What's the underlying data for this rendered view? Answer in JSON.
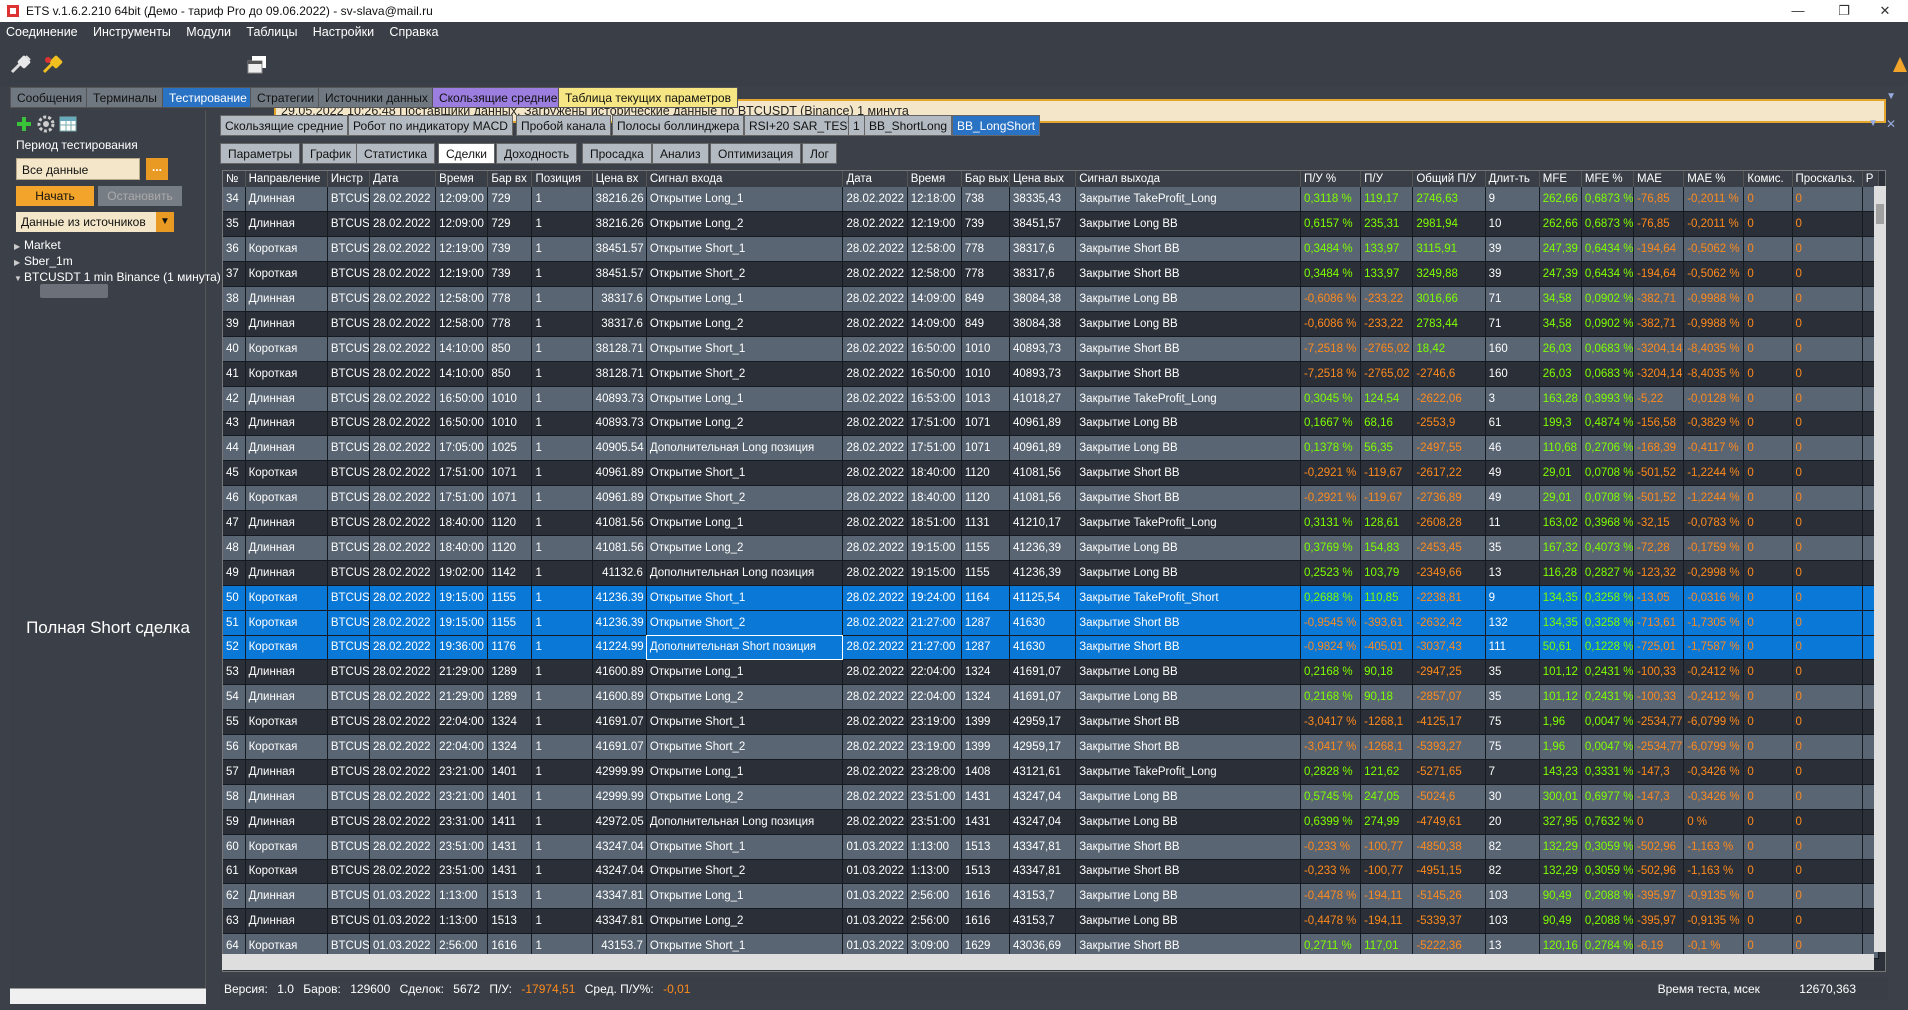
{
  "window": {
    "title": "ETS v.1.6.2.210 64bit  (Демо - тариф Pro до 09.06.2022) - sv-slava@mail.ru",
    "minimize": "—",
    "restore": "❐",
    "close": "✕"
  },
  "menu": [
    "Соединение",
    "Инструменты",
    "Модули",
    "Таблицы",
    "Настройки",
    "Справка"
  ],
  "status_message": "29.05.2022 10:26:48 Поставщики данных. Загружены исторические данные по BTCUSDT (Binance) 1 минута",
  "main_tabs": [
    {
      "label": "Сообщения",
      "state": "normal"
    },
    {
      "label": "Терминалы",
      "state": "normal"
    },
    {
      "label": "Тестирование",
      "state": "active"
    },
    {
      "label": "Стратегии",
      "state": "normal"
    },
    {
      "label": "Источники данных",
      "state": "normal"
    },
    {
      "label": "Скользящие средние",
      "state": "purple"
    },
    {
      "label": "Таблица текущих параметров",
      "state": "yellow"
    }
  ],
  "sidebar": {
    "period_label": "Период тестирования",
    "period_value": "Все данные",
    "browse": "...",
    "start_button": "Начать",
    "stop_button": "Остановить",
    "source_select": "Данные из источников",
    "tree": [
      "Market",
      "Sber_1m",
      "BTCUSDT 1 min Binance (1 минута)"
    ],
    "annotation": "Полная Short сделка"
  },
  "strategy_tabs": [
    "Скользящие средние",
    "Робот по индикатору MACD",
    "Пробой канала",
    "Полосы боллинджера",
    "RSI+20 SAR_TEST",
    "1",
    "BB_ShortLong",
    "BB_LongShort"
  ],
  "strategy_active": 7,
  "sub_tabs": [
    "Параметры",
    "График",
    "Статистика",
    "Сделки",
    "Доходность",
    "Просадка",
    "Анализ",
    "Оптимизация",
    "Лог"
  ],
  "sub_active": 3,
  "table": {
    "columns": [
      "№",
      "Направление",
      "Инстр",
      "Дата",
      "Время",
      "Бар вх",
      "Позиция",
      "Цена вх",
      "Сигнал входа",
      "Дата",
      "Время",
      "Бар вых",
      "Цена вых",
      "Сигнал выхода",
      "П/У %",
      "П/У",
      "Общий П/У",
      "Длит-ть",
      "MFE",
      "MFE %",
      "MAE",
      "MAE %",
      "Комис.",
      "Проскальз.",
      "Р"
    ],
    "rows": [
      [
        "34",
        "Длинная",
        "BTCUSD",
        "28.02.2022",
        "12:09:00",
        "729",
        "1",
        "38216.26",
        "Открытие Long_1",
        "28.02.2022",
        "12:18:00",
        "738",
        "38335,43",
        "Закрытие TakeProfit_Long",
        "0,3118 %",
        "119,17",
        "2746,63",
        "9",
        "262,66",
        "0,6873 %",
        "-76,85",
        "-0,2011 %",
        "0",
        "0"
      ],
      [
        "35",
        "Длинная",
        "BTCUSD",
        "28.02.2022",
        "12:09:00",
        "729",
        "1",
        "38216.26",
        "Открытие Long_2",
        "28.02.2022",
        "12:19:00",
        "739",
        "38451,57",
        "Закрытие Long BB",
        "0,6157 %",
        "235,31",
        "2981,94",
        "10",
        "262,66",
        "0,6873 %",
        "-76,85",
        "-0,2011 %",
        "0",
        "0"
      ],
      [
        "36",
        "Короткая",
        "BTCUSD",
        "28.02.2022",
        "12:19:00",
        "739",
        "1",
        "38451.57",
        "Открытие Short_1",
        "28.02.2022",
        "12:58:00",
        "778",
        "38317,6",
        "Закрытие Short BB",
        "0,3484 %",
        "133,97",
        "3115,91",
        "39",
        "247,39",
        "0,6434 %",
        "-194,64",
        "-0,5062 %",
        "0",
        "0"
      ],
      [
        "37",
        "Короткая",
        "BTCUSD",
        "28.02.2022",
        "12:19:00",
        "739",
        "1",
        "38451.57",
        "Открытие Short_2",
        "28.02.2022",
        "12:58:00",
        "778",
        "38317,6",
        "Закрытие Short BB",
        "0,3484 %",
        "133,97",
        "3249,88",
        "39",
        "247,39",
        "0,6434 %",
        "-194,64",
        "-0,5062 %",
        "0",
        "0"
      ],
      [
        "38",
        "Длинная",
        "BTCUSD",
        "28.02.2022",
        "12:58:00",
        "778",
        "1",
        "38317.6",
        "Открытие Long_1",
        "28.02.2022",
        "14:09:00",
        "849",
        "38084,38",
        "Закрытие Long BB",
        "-0,6086 %",
        "-233,22",
        "3016,66",
        "71",
        "34,58",
        "0,0902 %",
        "-382,71",
        "-0,9988 %",
        "0",
        "0"
      ],
      [
        "39",
        "Длинная",
        "BTCUSD",
        "28.02.2022",
        "12:58:00",
        "778",
        "1",
        "38317.6",
        "Открытие Long_2",
        "28.02.2022",
        "14:09:00",
        "849",
        "38084,38",
        "Закрытие Long BB",
        "-0,6086 %",
        "-233,22",
        "2783,44",
        "71",
        "34,58",
        "0,0902 %",
        "-382,71",
        "-0,9988 %",
        "0",
        "0"
      ],
      [
        "40",
        "Короткая",
        "BTCUSD",
        "28.02.2022",
        "14:10:00",
        "850",
        "1",
        "38128.71",
        "Открытие Short_1",
        "28.02.2022",
        "16:50:00",
        "1010",
        "40893,73",
        "Закрытие Short BB",
        "-7,2518 %",
        "-2765,02",
        "18,42",
        "160",
        "26,03",
        "0,0683 %",
        "-3204,14",
        "-8,4035 %",
        "0",
        "0"
      ],
      [
        "41",
        "Короткая",
        "BTCUSD",
        "28.02.2022",
        "14:10:00",
        "850",
        "1",
        "38128.71",
        "Открытие Short_2",
        "28.02.2022",
        "16:50:00",
        "1010",
        "40893,73",
        "Закрытие Short BB",
        "-7,2518 %",
        "-2765,02",
        "-2746,6",
        "160",
        "26,03",
        "0,0683 %",
        "-3204,14",
        "-8,4035 %",
        "0",
        "0"
      ],
      [
        "42",
        "Длинная",
        "BTCUSD",
        "28.02.2022",
        "16:50:00",
        "1010",
        "1",
        "40893.73",
        "Открытие Long_1",
        "28.02.2022",
        "16:53:00",
        "1013",
        "41018,27",
        "Закрытие TakeProfit_Long",
        "0,3045 %",
        "124,54",
        "-2622,06",
        "3",
        "163,28",
        "0,3993 %",
        "-5,22",
        "-0,0128 %",
        "0",
        "0"
      ],
      [
        "43",
        "Длинная",
        "BTCUSD",
        "28.02.2022",
        "16:50:00",
        "1010",
        "1",
        "40893.73",
        "Открытие Long_2",
        "28.02.2022",
        "17:51:00",
        "1071",
        "40961,89",
        "Закрытие Long BB",
        "0,1667 %",
        "68,16",
        "-2553,9",
        "61",
        "199,3",
        "0,4874 %",
        "-156,58",
        "-0,3829 %",
        "0",
        "0"
      ],
      [
        "44",
        "Длинная",
        "BTCUSD",
        "28.02.2022",
        "17:05:00",
        "1025",
        "1",
        "40905.54",
        "Дополнительная Long позиция",
        "28.02.2022",
        "17:51:00",
        "1071",
        "40961,89",
        "Закрытие Long BB",
        "0,1378 %",
        "56,35",
        "-2497,55",
        "46",
        "110,68",
        "0,2706 %",
        "-168,39",
        "-0,4117 %",
        "0",
        "0"
      ],
      [
        "45",
        "Короткая",
        "BTCUSD",
        "28.02.2022",
        "17:51:00",
        "1071",
        "1",
        "40961.89",
        "Открытие Short_1",
        "28.02.2022",
        "18:40:00",
        "1120",
        "41081,56",
        "Закрытие Short BB",
        "-0,2921 %",
        "-119,67",
        "-2617,22",
        "49",
        "29,01",
        "0,0708 %",
        "-501,52",
        "-1,2244 %",
        "0",
        "0"
      ],
      [
        "46",
        "Короткая",
        "BTCUSD",
        "28.02.2022",
        "17:51:00",
        "1071",
        "1",
        "40961.89",
        "Открытие Short_2",
        "28.02.2022",
        "18:40:00",
        "1120",
        "41081,56",
        "Закрытие Short BB",
        "-0,2921 %",
        "-119,67",
        "-2736,89",
        "49",
        "29,01",
        "0,0708 %",
        "-501,52",
        "-1,2244 %",
        "0",
        "0"
      ],
      [
        "47",
        "Длинная",
        "BTCUSD",
        "28.02.2022",
        "18:40:00",
        "1120",
        "1",
        "41081.56",
        "Открытие Long_1",
        "28.02.2022",
        "18:51:00",
        "1131",
        "41210,17",
        "Закрытие TakeProfit_Long",
        "0,3131 %",
        "128,61",
        "-2608,28",
        "11",
        "163,02",
        "0,3968 %",
        "-32,15",
        "-0,0783 %",
        "0",
        "0"
      ],
      [
        "48",
        "Длинная",
        "BTCUSD",
        "28.02.2022",
        "18:40:00",
        "1120",
        "1",
        "41081.56",
        "Открытие Long_2",
        "28.02.2022",
        "19:15:00",
        "1155",
        "41236,39",
        "Закрытие Long BB",
        "0,3769 %",
        "154,83",
        "-2453,45",
        "35",
        "167,32",
        "0,4073 %",
        "-72,28",
        "-0,1759 %",
        "0",
        "0"
      ],
      [
        "49",
        "Длинная",
        "BTCUSD",
        "28.02.2022",
        "19:02:00",
        "1142",
        "1",
        "41132.6",
        "Дополнительная Long позиция",
        "28.02.2022",
        "19:15:00",
        "1155",
        "41236,39",
        "Закрытие Long BB",
        "0,2523 %",
        "103,79",
        "-2349,66",
        "13",
        "116,28",
        "0,2827 %",
        "-123,32",
        "-0,2998 %",
        "0",
        "0"
      ],
      [
        "50",
        "Короткая",
        "BTCUSD",
        "28.02.2022",
        "19:15:00",
        "1155",
        "1",
        "41236.39",
        "Открытие Short_1",
        "28.02.2022",
        "19:24:00",
        "1164",
        "41125,54",
        "Закрытие TakeProfit_Short",
        "0,2688 %",
        "110,85",
        "-2238,81",
        "9",
        "134,35",
        "0,3258 %",
        "-13,05",
        "-0,0316 %",
        "0",
        "0"
      ],
      [
        "51",
        "Короткая",
        "BTCUSD",
        "28.02.2022",
        "19:15:00",
        "1155",
        "1",
        "41236.39",
        "Открытие Short_2",
        "28.02.2022",
        "21:27:00",
        "1287",
        "41630",
        "Закрытие Short BB",
        "-0,9545 %",
        "-393,61",
        "-2632,42",
        "132",
        "134,35",
        "0,3258 %",
        "-713,61",
        "-1,7305 %",
        "0",
        "0"
      ],
      [
        "52",
        "Короткая",
        "BTCUSD",
        "28.02.2022",
        "19:36:00",
        "1176",
        "1",
        "41224.99",
        "Дополнительная Short позиция",
        "28.02.2022",
        "21:27:00",
        "1287",
        "41630",
        "Закрытие Short BB",
        "-0,9824 %",
        "-405,01",
        "-3037,43",
        "111",
        "50,61",
        "0,1228 %",
        "-725,01",
        "-1,7587 %",
        "0",
        "0"
      ],
      [
        "53",
        "Длинная",
        "BTCUSD",
        "28.02.2022",
        "21:29:00",
        "1289",
        "1",
        "41600.89",
        "Открытие Long_1",
        "28.02.2022",
        "22:04:00",
        "1324",
        "41691,07",
        "Закрытие Long BB",
        "0,2168 %",
        "90,18",
        "-2947,25",
        "35",
        "101,12",
        "0,2431 %",
        "-100,33",
        "-0,2412 %",
        "0",
        "0"
      ],
      [
        "54",
        "Длинная",
        "BTCUSD",
        "28.02.2022",
        "21:29:00",
        "1289",
        "1",
        "41600.89",
        "Открытие Long_2",
        "28.02.2022",
        "22:04:00",
        "1324",
        "41691,07",
        "Закрытие Long BB",
        "0,2168 %",
        "90,18",
        "-2857,07",
        "35",
        "101,12",
        "0,2431 %",
        "-100,33",
        "-0,2412 %",
        "0",
        "0"
      ],
      [
        "55",
        "Короткая",
        "BTCUSD",
        "28.02.2022",
        "22:04:00",
        "1324",
        "1",
        "41691.07",
        "Открытие Short_1",
        "28.02.2022",
        "23:19:00",
        "1399",
        "42959,17",
        "Закрытие Short BB",
        "-3,0417 %",
        "-1268,1",
        "-4125,17",
        "75",
        "1,96",
        "0,0047 %",
        "-2534,77",
        "-6,0799 %",
        "0",
        "0"
      ],
      [
        "56",
        "Короткая",
        "BTCUSD",
        "28.02.2022",
        "22:04:00",
        "1324",
        "1",
        "41691.07",
        "Открытие Short_2",
        "28.02.2022",
        "23:19:00",
        "1399",
        "42959,17",
        "Закрытие Short BB",
        "-3,0417 %",
        "-1268,1",
        "-5393,27",
        "75",
        "1,96",
        "0,0047 %",
        "-2534,77",
        "-6,0799 %",
        "0",
        "0"
      ],
      [
        "57",
        "Длинная",
        "BTCUSD",
        "28.02.2022",
        "23:21:00",
        "1401",
        "1",
        "42999.99",
        "Открытие Long_1",
        "28.02.2022",
        "23:28:00",
        "1408",
        "43121,61",
        "Закрытие TakeProfit_Long",
        "0,2828 %",
        "121,62",
        "-5271,65",
        "7",
        "143,23",
        "0,3331 %",
        "-147,3",
        "-0,3426 %",
        "0",
        "0"
      ],
      [
        "58",
        "Длинная",
        "BTCUSD",
        "28.02.2022",
        "23:21:00",
        "1401",
        "1",
        "42999.99",
        "Открытие Long_2",
        "28.02.2022",
        "23:51:00",
        "1431",
        "43247,04",
        "Закрытие Long BB",
        "0,5745 %",
        "247,05",
        "-5024,6",
        "30",
        "300,01",
        "0,6977 %",
        "-147,3",
        "-0,3426 %",
        "0",
        "0"
      ],
      [
        "59",
        "Длинная",
        "BTCUSD",
        "28.02.2022",
        "23:31:00",
        "1411",
        "1",
        "42972.05",
        "Дополнительная Long позиция",
        "28.02.2022",
        "23:51:00",
        "1431",
        "43247,04",
        "Закрытие Long BB",
        "0,6399 %",
        "274,99",
        "-4749,61",
        "20",
        "327,95",
        "0,7632 %",
        "0",
        "0 %",
        "0",
        "0"
      ],
      [
        "60",
        "Короткая",
        "BTCUSD",
        "28.02.2022",
        "23:51:00",
        "1431",
        "1",
        "43247.04",
        "Открытие Short_1",
        "01.03.2022",
        "1:13:00",
        "1513",
        "43347,81",
        "Закрытие Short BB",
        "-0,233 %",
        "-100,77",
        "-4850,38",
        "82",
        "132,29",
        "0,3059 %",
        "-502,96",
        "-1,163 %",
        "0",
        "0"
      ],
      [
        "61",
        "Короткая",
        "BTCUSD",
        "28.02.2022",
        "23:51:00",
        "1431",
        "1",
        "43247.04",
        "Открытие Short_2",
        "01.03.2022",
        "1:13:00",
        "1513",
        "43347,81",
        "Закрытие Short BB",
        "-0,233 %",
        "-100,77",
        "-4951,15",
        "82",
        "132,29",
        "0,3059 %",
        "-502,96",
        "-1,163 %",
        "0",
        "0"
      ],
      [
        "62",
        "Длинная",
        "BTCUSD",
        "01.03.2022",
        "1:13:00",
        "1513",
        "1",
        "43347.81",
        "Открытие Long_1",
        "01.03.2022",
        "2:56:00",
        "1616",
        "43153,7",
        "Закрытие Long BB",
        "-0,4478 %",
        "-194,11",
        "-5145,26",
        "103",
        "90,49",
        "0,2088 %",
        "-395,97",
        "-0,9135 %",
        "0",
        "0"
      ],
      [
        "63",
        "Длинная",
        "BTCUSD",
        "01.03.2022",
        "1:13:00",
        "1513",
        "1",
        "43347.81",
        "Открытие Long_2",
        "01.03.2022",
        "2:56:00",
        "1616",
        "43153,7",
        "Закрытие Long BB",
        "-0,4478 %",
        "-194,11",
        "-5339,37",
        "103",
        "90,49",
        "0,2088 %",
        "-395,97",
        "-0,9135 %",
        "0",
        "0"
      ],
      [
        "64",
        "Короткая",
        "BTCUSD",
        "01.03.2022",
        "2:56:00",
        "1616",
        "1",
        "43153.7",
        "Открытие Short_1",
        "01.03.2022",
        "3:09:00",
        "1629",
        "43036,69",
        "Закрытие Short BB",
        "0,2711 %",
        "117,01",
        "-5222,36",
        "13",
        "120,16",
        "0,2784 %",
        "-6,19",
        "-0,1 %",
        "0",
        "0"
      ]
    ],
    "selected_rows": [
      "50",
      "51",
      "52"
    ]
  },
  "footer": {
    "version_label": "Версия:",
    "version": "1.0",
    "bars_label": "Баров:",
    "bars": "129600",
    "deals_label": "Сделок:",
    "deals": "5672",
    "pl_label": "П/У:",
    "pl": "-17974,51",
    "avg_label": "Сред. П/У%:",
    "avg": "-0,01",
    "time_label": "Время теста, мсек",
    "time": "12670,363"
  },
  "colors": {
    "accent": "#2a72c3",
    "selected_row": "#0a78d6",
    "positive": "#7fff00",
    "negative": "#ff8a1d",
    "status_border": "#e3a52b"
  }
}
